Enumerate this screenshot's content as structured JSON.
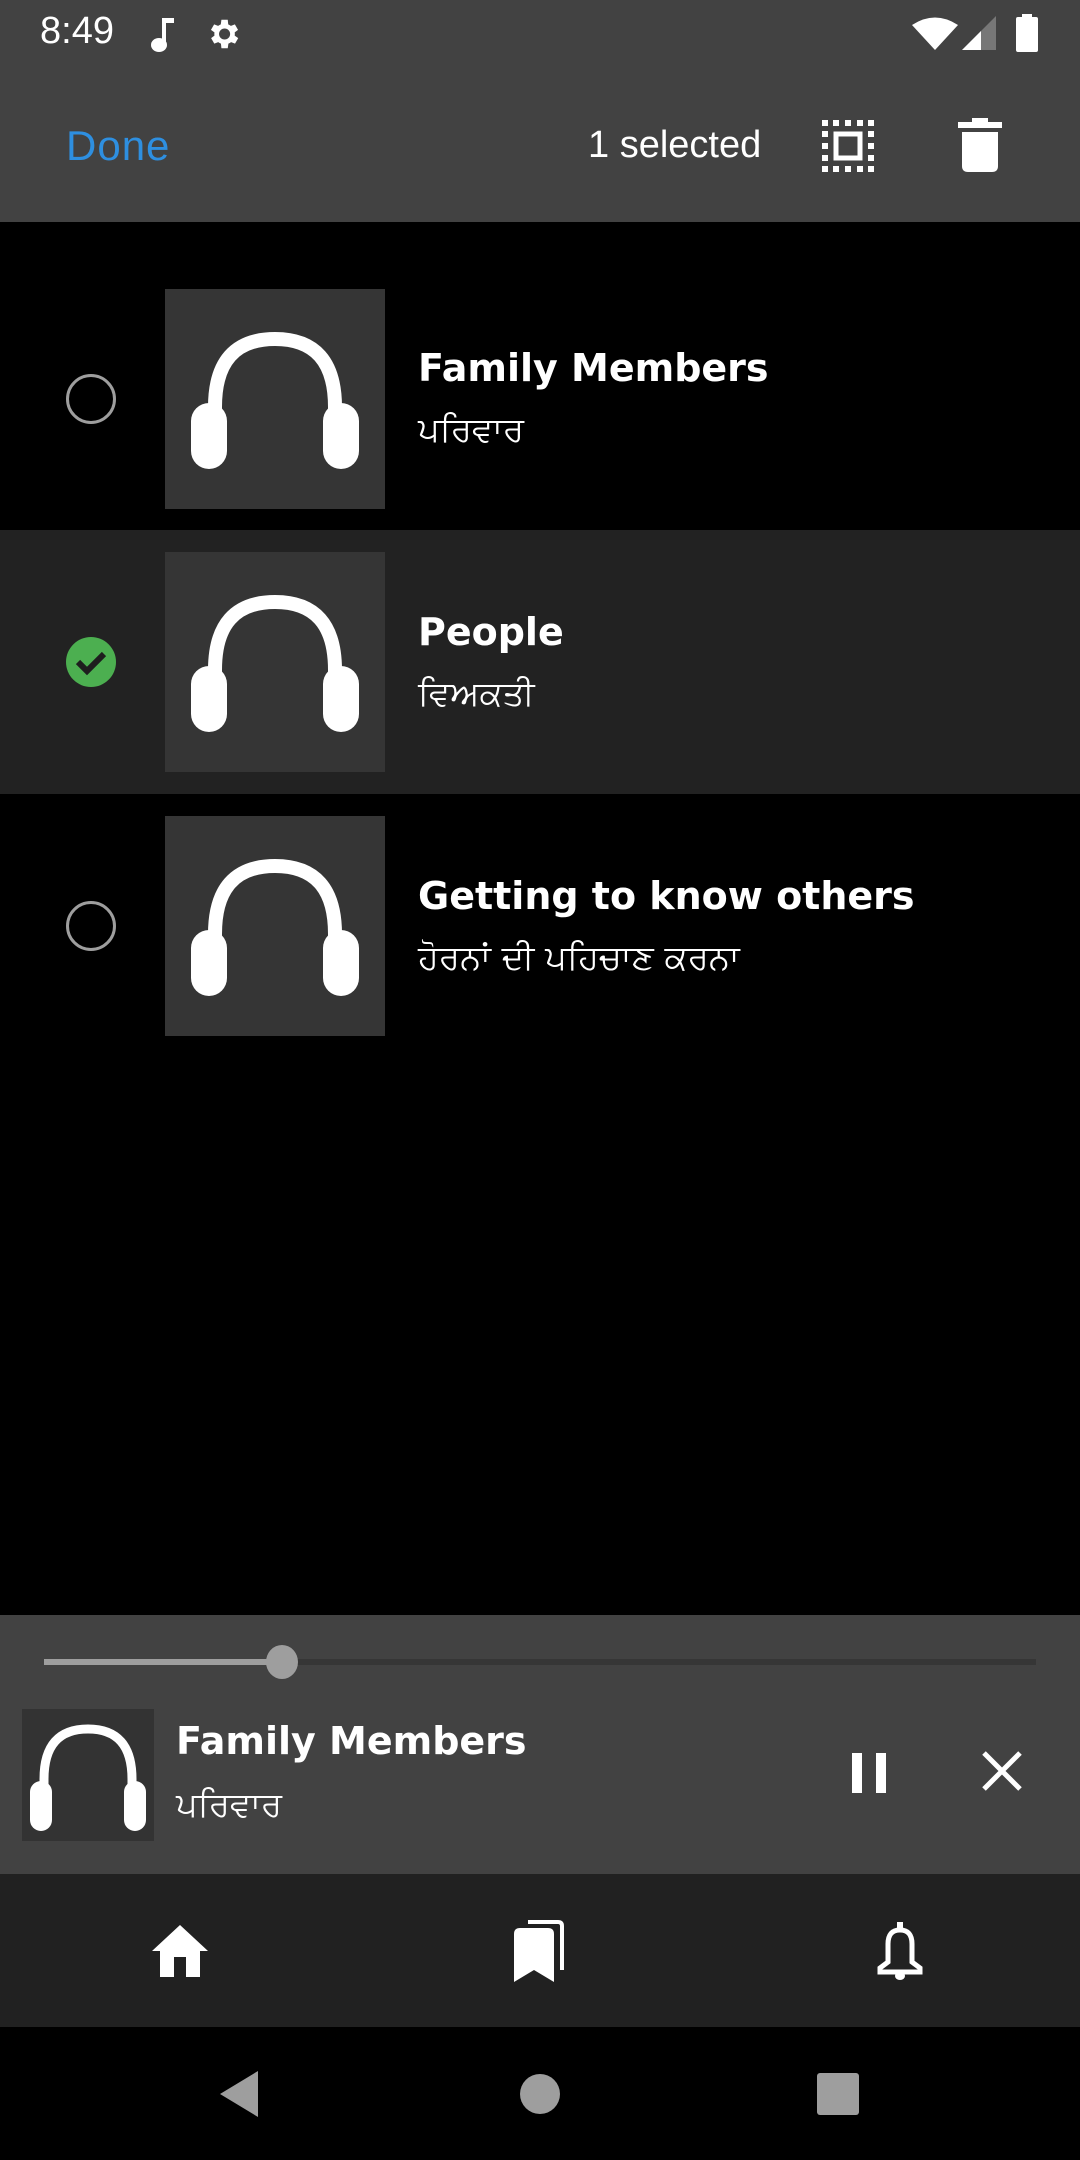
{
  "status_bar": {
    "time": "8:49",
    "left_icons": [
      "music-note-icon",
      "gear-icon"
    ],
    "right_icons": [
      "wifi-icon",
      "cellular-signal-icon",
      "battery-icon"
    ]
  },
  "header": {
    "done_label": "Done",
    "selected_count": "1 selected",
    "select_all_icon": "select-all-icon",
    "delete_icon": "trash-icon",
    "accent_color": "#2e8fe0"
  },
  "list": {
    "items": [
      {
        "title": "Family Members",
        "subtitle": "ਪਰਿਵਾਰ",
        "selected": false,
        "icon": "headphones-icon"
      },
      {
        "title": "People",
        "subtitle": "ਵਿਅਕਤੀ",
        "selected": true,
        "icon": "headphones-icon"
      },
      {
        "title": "Getting to know others",
        "subtitle": "ਹੋਰਨਾਂ ਦੀ ਪਹਿਚਾਣ ਕਰਨਾ",
        "selected": false,
        "icon": "headphones-icon"
      }
    ],
    "selected_color": "#4caf50"
  },
  "player": {
    "title": "Family Members",
    "subtitle": "ਪਰਿਵਾਰ",
    "progress_percent": 24,
    "pause_icon": "pause-icon",
    "close_icon": "close-icon"
  },
  "bottom_nav": {
    "items": [
      {
        "name": "home",
        "icon": "home-icon"
      },
      {
        "name": "bookmarks",
        "icon": "bookmarks-icon"
      },
      {
        "name": "notifications",
        "icon": "bell-icon"
      }
    ]
  },
  "system_nav": {
    "items": [
      "back-icon",
      "home-circle-icon",
      "recents-icon"
    ]
  }
}
